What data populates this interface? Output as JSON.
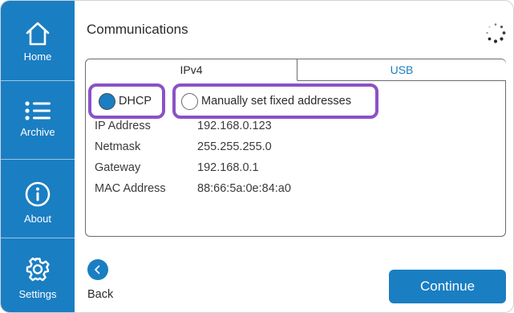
{
  "sidebar": {
    "items": [
      {
        "label": "Home",
        "icon": "home-icon"
      },
      {
        "label": "Archive",
        "icon": "list-icon"
      },
      {
        "label": "About",
        "icon": "info-icon"
      },
      {
        "label": "Settings",
        "icon": "gear-icon"
      }
    ]
  },
  "header": {
    "title": "Communications",
    "status_icon": "loading-spinner-icon"
  },
  "tabs": [
    {
      "label": "IPv4",
      "selected": true
    },
    {
      "label": "USB",
      "selected": false
    }
  ],
  "address_mode": {
    "options": [
      {
        "label": "DHCP",
        "checked": true
      },
      {
        "label": "Manually set fixed addresses",
        "checked": false
      }
    ]
  },
  "network": [
    {
      "label": "IP Address",
      "value": "192.168.0.123"
    },
    {
      "label": "Netmask",
      "value": "255.255.255.0"
    },
    {
      "label": "Gateway",
      "value": "192.168.0.1"
    },
    {
      "label": "MAC Address",
      "value": "88:66:5a:0e:84:a0"
    }
  ],
  "footer": {
    "back_label": "Back",
    "continue_label": "Continue"
  },
  "colors": {
    "primary": "#1a7ec2",
    "highlight": "#8a52c6",
    "text": "#2b2b2b"
  }
}
